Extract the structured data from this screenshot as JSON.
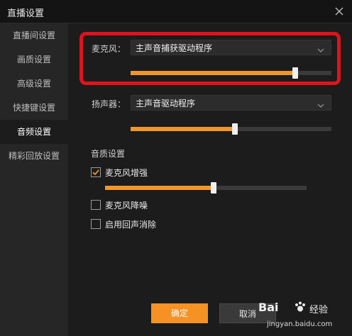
{
  "window": {
    "title": "直播设置"
  },
  "sidebar": {
    "items": [
      {
        "label": "直播间设置"
      },
      {
        "label": "画质设置"
      },
      {
        "label": "高级设置"
      },
      {
        "label": "快捷键设置"
      },
      {
        "label": "音频设置",
        "active": true
      },
      {
        "label": "精彩回放设置"
      }
    ]
  },
  "audio": {
    "microphone": {
      "label": "麦克风：",
      "device": "主声音捕获驱动程序",
      "volume_fraction": 0.82
    },
    "speaker": {
      "label": "扬声器：",
      "device": "主声音驱动程序",
      "volume_fraction": 0.52
    },
    "quality": {
      "title": "音质设置",
      "options": [
        {
          "label": "麦克风增强",
          "checked": true
        },
        {
          "label": "麦克风降噪",
          "checked": false
        },
        {
          "label": "启用回声消除",
          "checked": false
        }
      ],
      "boost_fraction": 0.54
    }
  },
  "buttons": {
    "ok": "确定",
    "cancel": "取消"
  },
  "watermark": {
    "brand": "Bai",
    "suffix": "经验",
    "url": "jingyan.baidu.com"
  },
  "colors": {
    "accent": "#f59223",
    "highlight": "#e0121b",
    "background": "#1c1c1c"
  },
  "icons": {
    "close": "close-icon",
    "dropdown": "chevron-down-icon",
    "check": "checkmark-icon"
  }
}
